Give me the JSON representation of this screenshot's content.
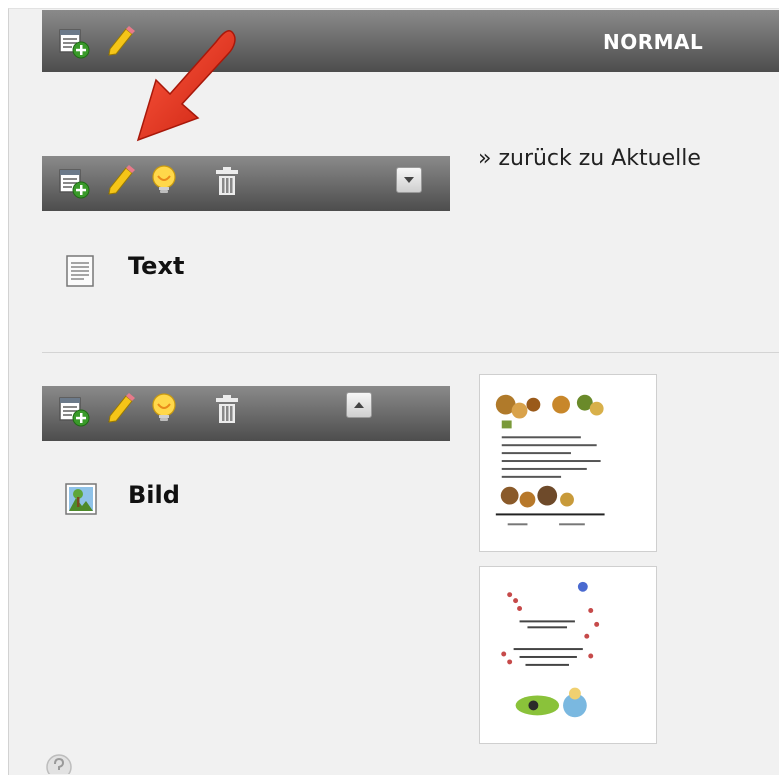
{
  "toolbar_top": {
    "label": "NORMAL",
    "icons": [
      "new-content-icon",
      "edit-icon"
    ]
  },
  "content_elements": [
    {
      "type_label": "Text",
      "type_icon": "text-document-icon",
      "toolbar_icons": [
        "new-content-icon",
        "edit-icon",
        "lightbulb-icon",
        "trash-icon"
      ],
      "move_button": "move-down-icon"
    },
    {
      "type_label": "Bild",
      "type_icon": "image-icon",
      "toolbar_icons": [
        "new-content-icon",
        "edit-icon",
        "lightbulb-icon",
        "trash-icon"
      ],
      "move_button": "move-up-icon"
    }
  ],
  "back_link": "» zurück zu Aktuelle",
  "annotation": {
    "icon": "red-arrow-icon",
    "color": "#e8321e"
  },
  "colors": {
    "bar_dark": "#4d4d4d",
    "bar_light": "#8a8a8a",
    "background": "#f1f1f1",
    "accent_green": "#3a9a2a",
    "pencil_yellow": "#f5c518"
  }
}
